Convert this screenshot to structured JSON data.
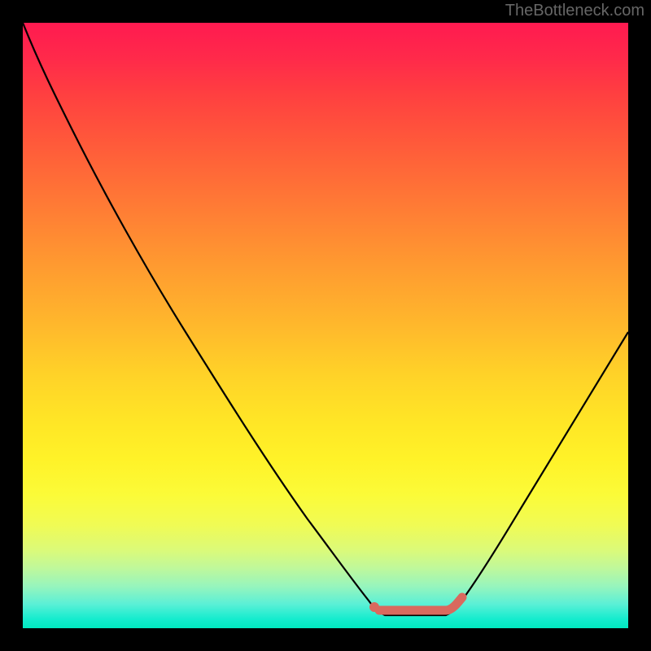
{
  "watermark": "TheBottleneck.com",
  "chart_data": {
    "type": "line",
    "title": "",
    "xlabel": "",
    "ylabel": "",
    "xlim": [
      0,
      100
    ],
    "ylim": [
      0,
      100
    ],
    "series": [
      {
        "name": "bottleneck-curve",
        "color": "#000000",
        "x": [
          0,
          5,
          10,
          15,
          20,
          25,
          30,
          35,
          40,
          45,
          50,
          55,
          58,
          60,
          65,
          70,
          72,
          75,
          80,
          85,
          90,
          95,
          100
        ],
        "values": [
          100,
          96,
          90,
          83,
          75,
          66,
          57,
          48,
          39,
          30,
          21,
          12,
          6,
          3,
          2,
          2,
          3,
          8,
          16,
          25,
          34,
          43,
          52
        ]
      },
      {
        "name": "optimal-marker",
        "color": "#d9695e",
        "type": "marker",
        "x": [
          58,
          60,
          62,
          64,
          66,
          68,
          70,
          71,
          72
        ],
        "values": [
          3.5,
          3,
          2.5,
          2.5,
          2.5,
          2.5,
          2.5,
          3,
          4
        ]
      }
    ],
    "gradient_stops": [
      {
        "pct": 0,
        "color": "#ff1a50"
      },
      {
        "pct": 50,
        "color": "#ffd228"
      },
      {
        "pct": 100,
        "color": "#00e9c0"
      }
    ]
  }
}
